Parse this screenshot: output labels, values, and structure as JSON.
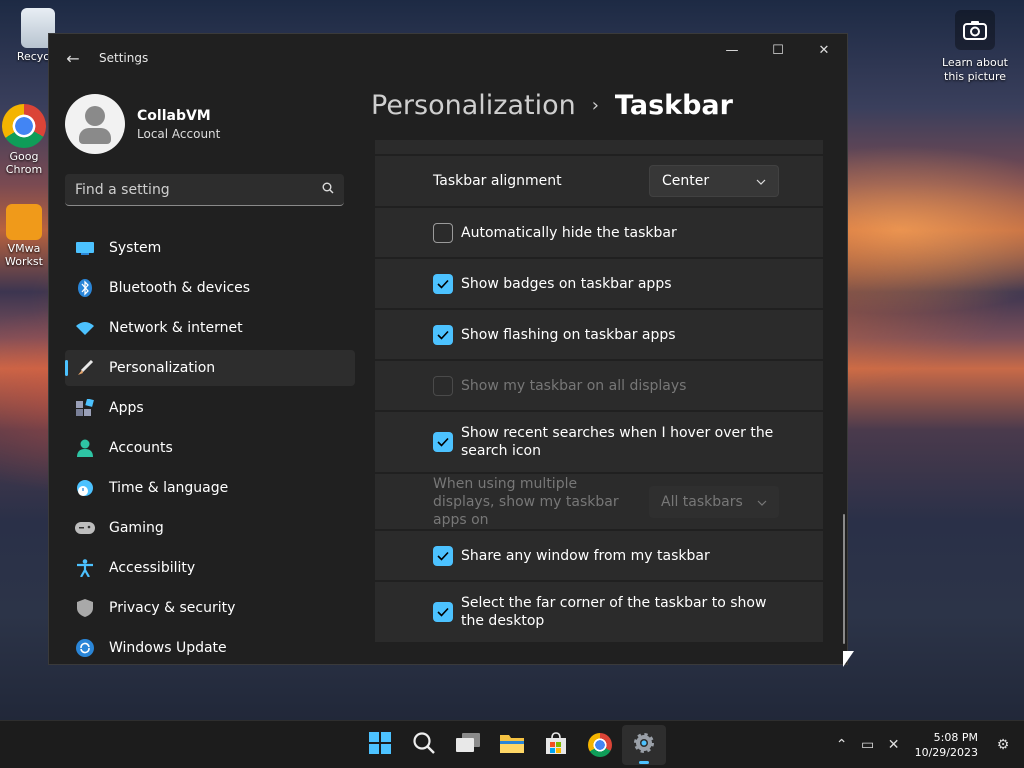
{
  "desktop": {
    "icons": [
      {
        "label": "Recycle"
      },
      {
        "label": "Goog Chrom"
      },
      {
        "label": "VMwa Workst"
      }
    ],
    "spotlight_label": "Learn about this picture"
  },
  "window": {
    "app_title": "Settings",
    "controls": {
      "minimize": "—",
      "maximize": "☐",
      "close": "✕"
    },
    "back_glyph": "←"
  },
  "profile": {
    "name": "CollabVM",
    "account_type": "Local Account"
  },
  "search": {
    "placeholder": "Find a setting",
    "icon": "search-icon"
  },
  "nav": [
    {
      "label": "System",
      "icon": "system-icon",
      "color": "#4cc2ff"
    },
    {
      "label": "Bluetooth & devices",
      "icon": "bluetooth-icon",
      "color": "#2a86d8"
    },
    {
      "label": "Network & internet",
      "icon": "wifi-icon",
      "color": "#4cc2ff"
    },
    {
      "label": "Personalization",
      "icon": "brush-icon",
      "color": "#e6a46a",
      "active": true
    },
    {
      "label": "Apps",
      "icon": "apps-icon",
      "color": "#9aa0b8"
    },
    {
      "label": "Accounts",
      "icon": "accounts-icon",
      "color": "#2ec4a4"
    },
    {
      "label": "Time & language",
      "icon": "time-language-icon",
      "color": "#4cc2ff"
    },
    {
      "label": "Gaming",
      "icon": "gaming-icon",
      "color": "#bdbdbd"
    },
    {
      "label": "Accessibility",
      "icon": "accessibility-icon",
      "color": "#4cc2ff"
    },
    {
      "label": "Privacy & security",
      "icon": "shield-icon",
      "color": "#a9a9a9"
    },
    {
      "label": "Windows Update",
      "icon": "update-icon",
      "color": "#2a86d8"
    }
  ],
  "page": {
    "breadcrumb_parent": "Personalization",
    "separator": "›",
    "title": "Taskbar"
  },
  "settings": {
    "alignment": {
      "label": "Taskbar alignment",
      "value": "Center"
    },
    "auto_hide": {
      "label": "Automatically hide the taskbar",
      "checked": false
    },
    "badges": {
      "label": "Show badges on taskbar apps",
      "checked": true
    },
    "flashing": {
      "label": "Show flashing on taskbar apps",
      "checked": true
    },
    "all_displays": {
      "label": "Show my taskbar on all displays",
      "checked": false,
      "disabled": true
    },
    "recent_searches": {
      "label": "Show recent searches when I hover over the search icon",
      "checked": true
    },
    "multi_display": {
      "label": "When using multiple displays, show my taskbar apps on",
      "value": "All taskbars",
      "disabled": true
    },
    "share_window": {
      "label": "Share any window from my taskbar",
      "checked": true
    },
    "far_corner": {
      "label": "Select the far corner of the taskbar to show the desktop",
      "checked": true
    }
  },
  "taskbar": {
    "apps": [
      "start-icon",
      "search-icon",
      "task-view-icon",
      "file-explorer-icon",
      "store-icon",
      "chrome-icon",
      "settings-icon"
    ],
    "active_app": "settings-icon",
    "time": "5:08 PM",
    "date": "10/29/2023"
  },
  "colors": {
    "accent": "#4cc2ff",
    "window_bg": "#202020",
    "card_bg": "#2b2b2b"
  }
}
